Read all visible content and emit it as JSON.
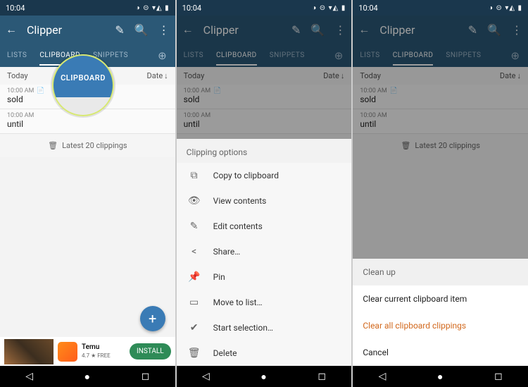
{
  "status": {
    "time": "10:04"
  },
  "app": {
    "title": "Clipper"
  },
  "tabs": {
    "lists": "LISTS",
    "clipboard": "CLIPBOARD",
    "snippets": "SNIPPETS"
  },
  "header": {
    "today": "Today",
    "date": "Date"
  },
  "entries": [
    {
      "time": "10:00 AM",
      "text": "sold",
      "copied": true
    },
    {
      "time": "10:00 AM",
      "text": "until",
      "copied": false
    }
  ],
  "latest": "Latest 20 clippings",
  "callout": "CLIPBOARD",
  "ad": {
    "name": "Temu",
    "rating": "4.7 ★  FREE",
    "cta": "INSTALL"
  },
  "sheet": {
    "title": "Clipping options",
    "items": [
      "Copy to clipboard",
      "View contents",
      "Edit contents",
      "Share…",
      "Pin",
      "Move to list…",
      "Start selection…",
      "Delete"
    ]
  },
  "dialog": {
    "title": "Clean up",
    "items": [
      "Clear current clipboard item",
      "Clear all clipboard clippings",
      "Cancel"
    ]
  }
}
